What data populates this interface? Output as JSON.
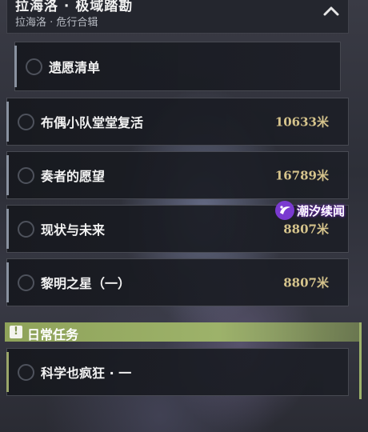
{
  "header": {
    "title": "拉海洛 · 极域踏勘",
    "subtitle": "拉海洛 · 危行合辑"
  },
  "quests": [
    {
      "name": "遗愿清单",
      "distance": ""
    },
    {
      "name": "布偶小队堂堂复活",
      "distance": "10633米"
    },
    {
      "name": "奏者的愿望",
      "distance": "16789米"
    },
    {
      "name": "现状与未来",
      "distance": "8807米"
    },
    {
      "name": "黎明之星（一）",
      "distance": "8807米"
    }
  ],
  "daily": {
    "section_label": "日常任务",
    "items": [
      {
        "name": "科学也疯狂 · 一"
      }
    ]
  },
  "watermark": {
    "text": "潮汐续闻"
  },
  "colors": {
    "accent_green": "#9db26a",
    "distance_gold": "#d6c48c",
    "watermark_purple": "#7a3ad0"
  }
}
